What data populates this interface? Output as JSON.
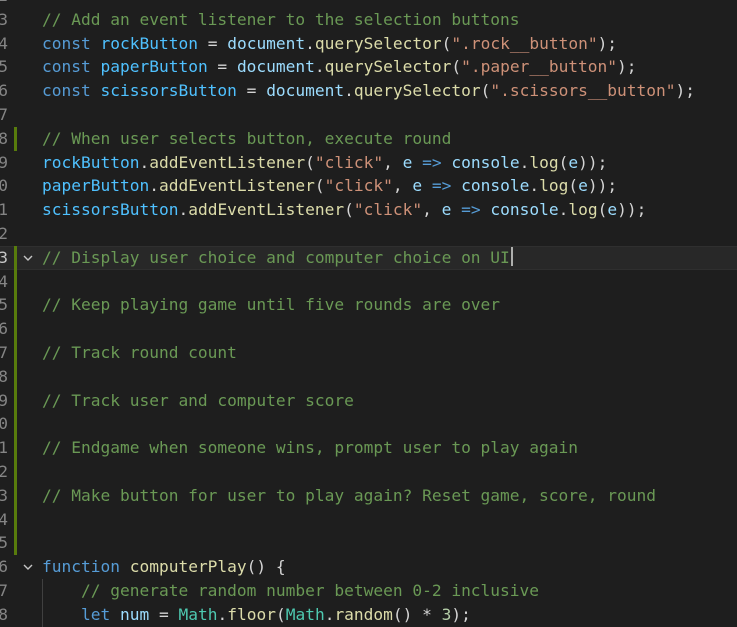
{
  "editor": {
    "lines": [
      {
        "n": "2",
        "mod": false,
        "fold": false,
        "tokens": []
      },
      {
        "n": "3",
        "mod": false,
        "fold": false,
        "tokens": [
          {
            "c": "cm",
            "t": "// Add an event listener to the selection buttons"
          }
        ]
      },
      {
        "n": "4",
        "mod": false,
        "fold": false,
        "tokens": [
          {
            "c": "kw",
            "t": "const"
          },
          {
            "c": "op",
            "t": " "
          },
          {
            "c": "var",
            "t": "rockButton"
          },
          {
            "c": "op",
            "t": " = "
          },
          {
            "c": "id",
            "t": "document"
          },
          {
            "c": "op",
            "t": "."
          },
          {
            "c": "fn",
            "t": "querySelector"
          },
          {
            "c": "op",
            "t": "("
          },
          {
            "c": "str",
            "t": "\".rock__button\""
          },
          {
            "c": "op",
            "t": ");"
          }
        ]
      },
      {
        "n": "5",
        "mod": false,
        "fold": false,
        "tokens": [
          {
            "c": "kw",
            "t": "const"
          },
          {
            "c": "op",
            "t": " "
          },
          {
            "c": "var",
            "t": "paperButton"
          },
          {
            "c": "op",
            "t": " = "
          },
          {
            "c": "id",
            "t": "document"
          },
          {
            "c": "op",
            "t": "."
          },
          {
            "c": "fn",
            "t": "querySelector"
          },
          {
            "c": "op",
            "t": "("
          },
          {
            "c": "str",
            "t": "\".paper__button\""
          },
          {
            "c": "op",
            "t": ");"
          }
        ]
      },
      {
        "n": "6",
        "mod": false,
        "fold": false,
        "tokens": [
          {
            "c": "kw",
            "t": "const"
          },
          {
            "c": "op",
            "t": " "
          },
          {
            "c": "var",
            "t": "scissorsButton"
          },
          {
            "c": "op",
            "t": " = "
          },
          {
            "c": "id",
            "t": "document"
          },
          {
            "c": "op",
            "t": "."
          },
          {
            "c": "fn",
            "t": "querySelector"
          },
          {
            "c": "op",
            "t": "("
          },
          {
            "c": "str",
            "t": "\".scissors__button\""
          },
          {
            "c": "op",
            "t": ");"
          }
        ]
      },
      {
        "n": "7",
        "mod": false,
        "fold": false,
        "tokens": []
      },
      {
        "n": "8",
        "mod": true,
        "fold": false,
        "tokens": [
          {
            "c": "cm",
            "t": "// When user selects button, execute round"
          }
        ]
      },
      {
        "n": "9",
        "mod": false,
        "fold": false,
        "tokens": [
          {
            "c": "var",
            "t": "rockButton"
          },
          {
            "c": "op",
            "t": "."
          },
          {
            "c": "fn",
            "t": "addEventListener"
          },
          {
            "c": "op",
            "t": "("
          },
          {
            "c": "str",
            "t": "\"click\""
          },
          {
            "c": "op",
            "t": ", "
          },
          {
            "c": "id",
            "t": "e"
          },
          {
            "c": "op",
            "t": " "
          },
          {
            "c": "arrow",
            "t": "=>"
          },
          {
            "c": "op",
            "t": " "
          },
          {
            "c": "id",
            "t": "console"
          },
          {
            "c": "op",
            "t": "."
          },
          {
            "c": "fn",
            "t": "log"
          },
          {
            "c": "op",
            "t": "("
          },
          {
            "c": "id",
            "t": "e"
          },
          {
            "c": "op",
            "t": "));"
          }
        ]
      },
      {
        "n": "0",
        "mod": false,
        "fold": false,
        "tokens": [
          {
            "c": "var",
            "t": "paperButton"
          },
          {
            "c": "op",
            "t": "."
          },
          {
            "c": "fn",
            "t": "addEventListener"
          },
          {
            "c": "op",
            "t": "("
          },
          {
            "c": "str",
            "t": "\"click\""
          },
          {
            "c": "op",
            "t": ", "
          },
          {
            "c": "id",
            "t": "e"
          },
          {
            "c": "op",
            "t": " "
          },
          {
            "c": "arrow",
            "t": "=>"
          },
          {
            "c": "op",
            "t": " "
          },
          {
            "c": "id",
            "t": "console"
          },
          {
            "c": "op",
            "t": "."
          },
          {
            "c": "fn",
            "t": "log"
          },
          {
            "c": "op",
            "t": "("
          },
          {
            "c": "id",
            "t": "e"
          },
          {
            "c": "op",
            "t": "));"
          }
        ]
      },
      {
        "n": "1",
        "mod": false,
        "fold": false,
        "tokens": [
          {
            "c": "var",
            "t": "scissorsButton"
          },
          {
            "c": "op",
            "t": "."
          },
          {
            "c": "fn",
            "t": "addEventListener"
          },
          {
            "c": "op",
            "t": "("
          },
          {
            "c": "str",
            "t": "\"click\""
          },
          {
            "c": "op",
            "t": ", "
          },
          {
            "c": "id",
            "t": "e"
          },
          {
            "c": "op",
            "t": " "
          },
          {
            "c": "arrow",
            "t": "=>"
          },
          {
            "c": "op",
            "t": " "
          },
          {
            "c": "id",
            "t": "console"
          },
          {
            "c": "op",
            "t": "."
          },
          {
            "c": "fn",
            "t": "log"
          },
          {
            "c": "op",
            "t": "("
          },
          {
            "c": "id",
            "t": "e"
          },
          {
            "c": "op",
            "t": "));"
          }
        ]
      },
      {
        "n": "2",
        "mod": false,
        "fold": false,
        "tokens": []
      },
      {
        "n": "3",
        "mod": true,
        "fold": true,
        "current": true,
        "cursor": true,
        "tokens": [
          {
            "c": "cm",
            "t": "// Display user choice and computer choice on UI"
          }
        ]
      },
      {
        "n": "4",
        "mod": true,
        "fold": false,
        "tokens": []
      },
      {
        "n": "5",
        "mod": true,
        "fold": false,
        "tokens": [
          {
            "c": "cm",
            "t": "// Keep playing game until five rounds are over"
          }
        ]
      },
      {
        "n": "6",
        "mod": true,
        "fold": false,
        "tokens": []
      },
      {
        "n": "7",
        "mod": true,
        "fold": false,
        "tokens": [
          {
            "c": "cm",
            "t": "// Track round count"
          }
        ]
      },
      {
        "n": "8",
        "mod": true,
        "fold": false,
        "tokens": []
      },
      {
        "n": "9",
        "mod": true,
        "fold": false,
        "tokens": [
          {
            "c": "cm",
            "t": "// Track user and computer score"
          }
        ]
      },
      {
        "n": "0",
        "mod": true,
        "fold": false,
        "tokens": []
      },
      {
        "n": "1",
        "mod": true,
        "fold": false,
        "tokens": [
          {
            "c": "cm",
            "t": "// Endgame when someone wins, prompt user to play again"
          }
        ]
      },
      {
        "n": "2",
        "mod": true,
        "fold": false,
        "tokens": []
      },
      {
        "n": "3",
        "mod": true,
        "fold": false,
        "tokens": [
          {
            "c": "cm",
            "t": "// Make button for user to play again? Reset game, score, round"
          }
        ]
      },
      {
        "n": "4",
        "mod": true,
        "fold": false,
        "tokens": []
      },
      {
        "n": "5",
        "mod": true,
        "fold": false,
        "tokens": []
      },
      {
        "n": "6",
        "mod": false,
        "fold": true,
        "tokens": [
          {
            "c": "kw",
            "t": "function"
          },
          {
            "c": "op",
            "t": " "
          },
          {
            "c": "fn",
            "t": "computerPlay"
          },
          {
            "c": "op",
            "t": "() {"
          }
        ]
      },
      {
        "n": "7",
        "mod": false,
        "fold": false,
        "guide": true,
        "tokens": [
          {
            "c": "op",
            "t": "    "
          },
          {
            "c": "cm",
            "t": "// generate random number between 0-2 inclusive"
          }
        ]
      },
      {
        "n": "8",
        "mod": false,
        "fold": false,
        "guide": true,
        "tokens": [
          {
            "c": "op",
            "t": "    "
          },
          {
            "c": "kw",
            "t": "let"
          },
          {
            "c": "op",
            "t": " "
          },
          {
            "c": "id",
            "t": "num"
          },
          {
            "c": "op",
            "t": " = "
          },
          {
            "c": "cls",
            "t": "Math"
          },
          {
            "c": "op",
            "t": "."
          },
          {
            "c": "fn",
            "t": "floor"
          },
          {
            "c": "op",
            "t": "("
          },
          {
            "c": "cls",
            "t": "Math"
          },
          {
            "c": "op",
            "t": "."
          },
          {
            "c": "fn",
            "t": "random"
          },
          {
            "c": "op",
            "t": "() * "
          },
          {
            "c": "num",
            "t": "3"
          },
          {
            "c": "op",
            "t": ");"
          }
        ]
      }
    ]
  }
}
